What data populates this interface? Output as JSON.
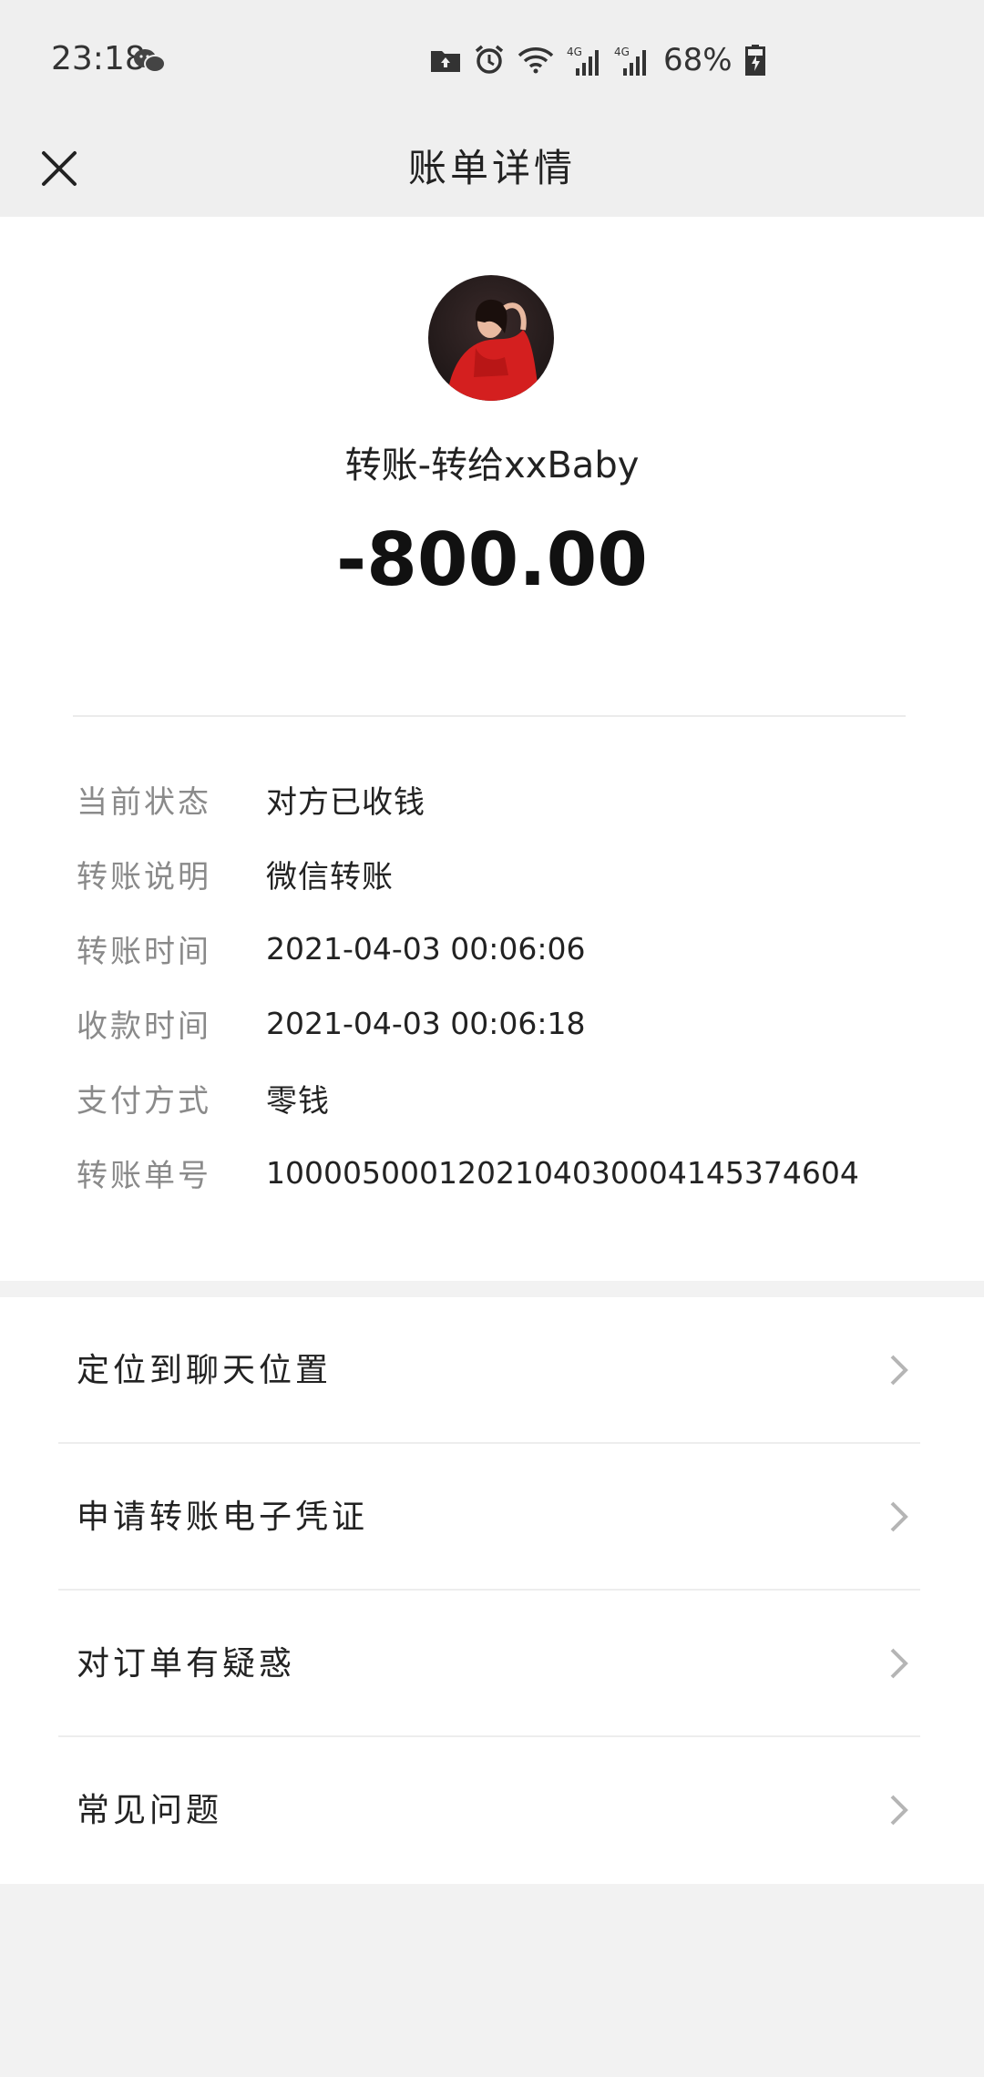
{
  "status_bar": {
    "time": "23:18",
    "battery": "68%",
    "network": [
      "4G",
      "4G"
    ]
  },
  "nav": {
    "title": "账单详情"
  },
  "header": {
    "payee_title": "转账-转给xxBaby",
    "amount": "-800.00"
  },
  "details": [
    {
      "label": "当前状态",
      "value": "对方已收钱"
    },
    {
      "label": "转账说明",
      "value": "微信转账"
    },
    {
      "label": "转账时间",
      "value": "2021-04-03 00:06:06"
    },
    {
      "label": "收款时间",
      "value": "2021-04-03 00:06:18"
    },
    {
      "label": "支付方式",
      "value": "零钱"
    },
    {
      "label": "转账单号",
      "value": "1000050001202104030004145374604"
    }
  ],
  "actions": [
    {
      "label": "定位到聊天位置"
    },
    {
      "label": "申请转账电子凭证"
    },
    {
      "label": "对订单有疑惑"
    },
    {
      "label": "常见问题"
    }
  ],
  "colors": {
    "nav_bg": "#efefef",
    "card_bg": "#ffffff",
    "label_gray": "#8a8a8a",
    "avatar_red": "#d41f1f"
  }
}
